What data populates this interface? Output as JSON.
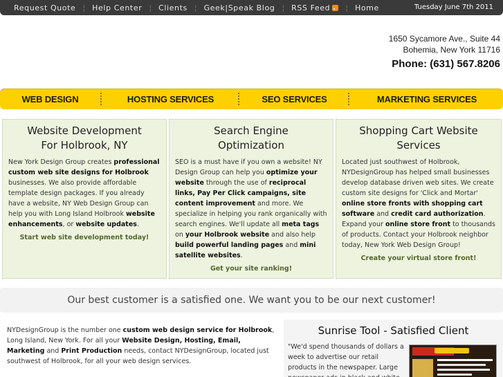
{
  "topnav": {
    "items": [
      "Request Quote",
      "Help Center",
      "Clients",
      "Geek|Speak Blog",
      "RSS Feed",
      "Home"
    ],
    "date": "Tuesday June 7th 2011"
  },
  "address": {
    "line1": "1650 Sycamore Ave., Suite 44",
    "line2": "Bohemia, New York 11716",
    "phone": "Phone: (631) 567.8206"
  },
  "mainnav": {
    "items": [
      "WEB DESIGN",
      "HOSTING SERVICES",
      "SEO SERVICES",
      "MARKETING SERVICES"
    ]
  },
  "columns": [
    {
      "title1": "Website Development",
      "title2": "For Holbrook, NY",
      "cta": "Start web site development today!",
      "text": [
        "New York Design Group creates ",
        "professional custom web site designs for Holbrook",
        " businesses. We also provide affordable template design packages. If you already have a website, NY Web Design Group can help you with Long Island Holbrook ",
        "website enhancements",
        ", or ",
        "website updates",
        "."
      ]
    },
    {
      "title1": "Search Engine",
      "title2": "Optimization",
      "cta": "Get your site ranking!",
      "text": [
        "SEO is a must have if you own a website! NY Design Group can help you ",
        "optimize your website",
        " through the use of ",
        "reciprocal links, Pay Per Click campaigns, site content improvement",
        " and more. We specialize in helping you rank organically with search engines. We'll update all ",
        "meta tags",
        " on ",
        "your Holbrook website",
        " and also help ",
        "build powerful landing pages",
        " and ",
        "mini satellite websites",
        "."
      ]
    },
    {
      "title1": "Shopping Cart Website",
      "title2": "Services",
      "cta": "Create your virtual store front!",
      "text": [
        "Located just southwest of Holbrook, NYDesignGroup has helped small businesses develop database driven web sites. We create custom site designs for 'Click and Mortar' ",
        "online store fronts with shopping cart software",
        " and ",
        "credit card authorization",
        ". Expand your ",
        "online store front",
        " to thousands of products. Contact your Holbrook neighbor today, New York Web Design Group!"
      ]
    }
  ],
  "banner": "Our best customer is a satisfied one. We want you to be our next customer!",
  "bottom": {
    "text": [
      "NYDesignGroup is the number one ",
      "custom web design service for Holbrook",
      ", Long Island, New York. For all your ",
      "Website Design, Hosting, Email, Marketing",
      " and ",
      "Print Production",
      " needs, contact NYDesignGroup, located just southwest of Holbrook, for all your web design services."
    ]
  },
  "client": {
    "title": "Sunrise Tool - Satisfied Client",
    "quote": "\"We'd spend thousands of dollars a week to advertise our retail products in the newspaper. Large newspaper ads in black and white"
  }
}
